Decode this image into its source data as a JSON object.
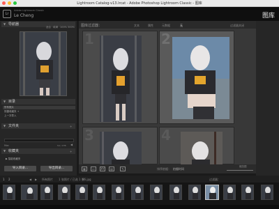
{
  "window": {
    "title": "Lightroom Catalog-v13.lrcat - Adobe Photoshop Lightroom Classic - 图库"
  },
  "identity": {
    "registered": "Adobe Lightroom Classic",
    "user": "Le Cheng",
    "active_module": "图库"
  },
  "left_panel": {
    "navigator": {
      "title": "导航器",
      "options": [
        "适合",
        "填满",
        "100%",
        "300%"
      ]
    },
    "catalog": {
      "title": "目录",
      "items": [
        "所有照片",
        "快捷收藏夹 +",
        "上一次导入"
      ]
    },
    "folders": {
      "title": "文件夹",
      "filter_placeholder": "过滤文件夹",
      "volume": "Mac",
      "volume_size": "54 / 1TB"
    },
    "collections": {
      "title": "收藏夹",
      "smart": "智能收藏夹"
    },
    "import_label": "导入目录...",
    "export_label": "导出目录..."
  },
  "content": {
    "filter_label": "图库过滤器：",
    "filter_tabs": [
      "文本",
      "属性",
      "元数据",
      "无"
    ],
    "filter_off": "过滤器关闭",
    "cells": [
      "1",
      "2",
      "3",
      "4"
    ]
  },
  "toolbar": {
    "sort_label": "排序依据：",
    "sort_value": "拍摄时间",
    "thumb_label": "缩览图"
  },
  "filmstrip": {
    "page_left": "1",
    "page_right": "2",
    "path": "所有照片",
    "count": "1 张照片 / 已选 1 张",
    "selected_file": "96.jpg",
    "filter_label": "过滤器："
  },
  "colors": {
    "accent": "#e6e6e6",
    "close": "#ff5f57",
    "min": "#febc2e",
    "max": "#28c840"
  }
}
